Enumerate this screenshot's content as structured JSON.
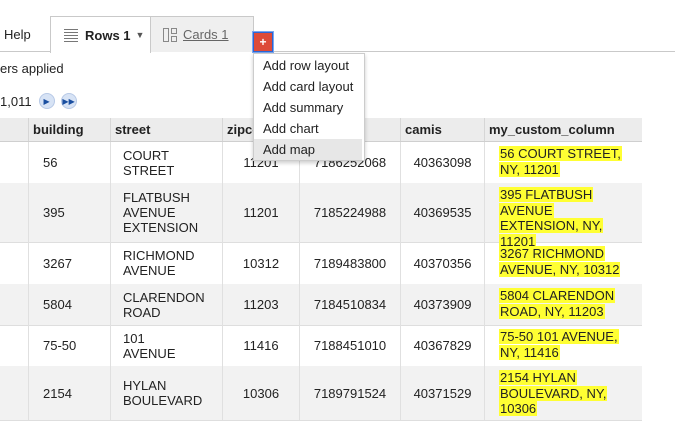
{
  "tabs": {
    "help": "Help",
    "rows": "Rows 1",
    "cards": "Cards 1",
    "add_button": "+"
  },
  "filters_text": "ers applied",
  "pager": {
    "count": "1,011"
  },
  "columns": [
    "building",
    "street",
    "zipco",
    "",
    "camis",
    "my_custom_column"
  ],
  "rows": [
    {
      "building": "56",
      "street": [
        "COURT",
        "STREET"
      ],
      "zipcode": "11201",
      "phone": "7186252068",
      "camis": "40363098",
      "custom": [
        "56 COURT STREET,",
        "NY, 11201"
      ]
    },
    {
      "building": "395",
      "street": [
        "FLATBUSH",
        "AVENUE",
        "EXTENSION"
      ],
      "zipcode": "11201",
      "phone": "7185224988",
      "camis": "40369535",
      "custom": [
        "395 FLATBUSH",
        "AVENUE",
        "EXTENSION, NY,",
        "11201"
      ]
    },
    {
      "building": "3267",
      "street": [
        "RICHMOND",
        "AVENUE"
      ],
      "zipcode": "10312",
      "phone": "7189483800",
      "camis": "40370356",
      "custom": [
        "3267 RICHMOND",
        "AVENUE, NY, 10312"
      ]
    },
    {
      "building": "5804",
      "street": [
        "CLARENDON",
        "ROAD"
      ],
      "zipcode": "11203",
      "phone": "7184510834",
      "camis": "40373909",
      "custom": [
        "5804 CLARENDON",
        "ROAD, NY, 11203"
      ]
    },
    {
      "building": "75-50",
      "street": [
        "101",
        "AVENUE"
      ],
      "zipcode": "11416",
      "phone": "7188451010",
      "camis": "40367829",
      "custom": [
        "75-50 101 AVENUE,",
        "NY, 11416"
      ]
    },
    {
      "building": "2154",
      "street": [
        "HYLAN",
        "BOULEVARD"
      ],
      "zipcode": "10306",
      "phone": "7189791524",
      "camis": "40371529",
      "custom": [
        "2154 HYLAN",
        "BOULEVARD, NY,",
        "10306"
      ]
    }
  ],
  "menu": [
    "Add row layout",
    "Add card layout",
    "Add summary",
    "Add chart",
    "Add map"
  ],
  "colors": {
    "highlight": "#ffff33",
    "add_button": "#dd4b39",
    "pager_button": "#d7e3f5"
  }
}
